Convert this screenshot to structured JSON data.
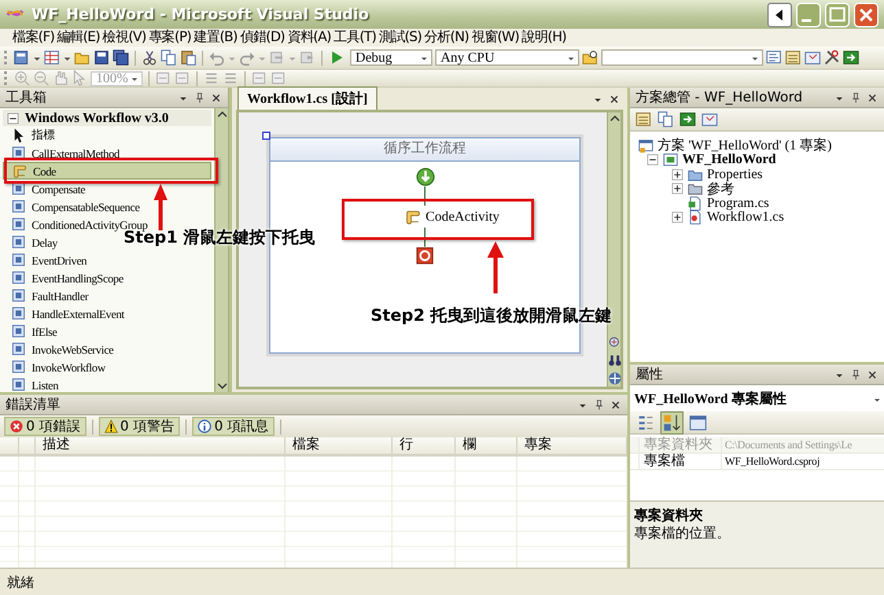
{
  "window": {
    "title": "WF_HelloWord - Microsoft Visual Studio"
  },
  "menu": [
    "檔案(F)",
    "編輯(E)",
    "檢視(V)",
    "專案(P)",
    "建置(B)",
    "偵錯(D)",
    "資料(A)",
    "工具(T)",
    "測試(S)",
    "分析(N)",
    "視窗(W)",
    "說明(H)"
  ],
  "toolbar": {
    "configuration": "Debug",
    "platform": "Any CPU",
    "zoom": "100%"
  },
  "toolbox": {
    "title": "工具箱",
    "group": {
      "label": "Windows Workflow v3.0",
      "expanded": true
    },
    "items": [
      {
        "label": "指標",
        "selected": false
      },
      {
        "label": "CallExternalMethod",
        "selected": false
      },
      {
        "label": "Code",
        "selected": true
      },
      {
        "label": "Compensate",
        "selected": false
      },
      {
        "label": "CompensatableSequence",
        "selected": false
      },
      {
        "label": "ConditionedActivityGroup",
        "selected": false
      },
      {
        "label": "Delay",
        "selected": false
      },
      {
        "label": "EventDriven",
        "selected": false
      },
      {
        "label": "EventHandlingScope",
        "selected": false
      },
      {
        "label": "FaultHandler",
        "selected": false
      },
      {
        "label": "HandleExternalEvent",
        "selected": false
      },
      {
        "label": "IfElse",
        "selected": false
      },
      {
        "label": "InvokeWebService",
        "selected": false
      },
      {
        "label": "InvokeWorkflow",
        "selected": false
      },
      {
        "label": "Listen",
        "selected": false
      }
    ]
  },
  "designer": {
    "tab": {
      "label": "Workflow1.cs [設計]",
      "selected": true
    },
    "workflow_title": "循序工作流程",
    "activities": [
      {
        "label": "CodeActivity"
      }
    ]
  },
  "solution_explorer": {
    "title": "方案總管 - WF_HelloWord",
    "tree": [
      {
        "kind": "solution",
        "label": "方案 'WF_HelloWord' (1 專案)",
        "children": [
          {
            "kind": "project",
            "label": "WF_HelloWord",
            "expanded": true,
            "children": [
              {
                "kind": "properties",
                "label": "Properties",
                "expanded": false
              },
              {
                "kind": "references",
                "label": "參考",
                "expanded": false
              },
              {
                "kind": "code",
                "label": "Program.cs"
              },
              {
                "kind": "workflow",
                "label": "Workflow1.cs",
                "expanded": false
              }
            ]
          }
        ]
      }
    ]
  },
  "properties": {
    "title": "屬性",
    "object": "WF_HelloWord 專案屬性",
    "sort_buttons": [
      {
        "kind": "categorized",
        "selected": false
      },
      {
        "kind": "alphabetical",
        "selected": true
      },
      {
        "kind": "pages",
        "selected": false
      }
    ],
    "rows": [
      {
        "name": "專案資料夾",
        "value": "C:\\Documents and Settings\\Le",
        "disabled": true
      },
      {
        "name": "專案檔",
        "value": "WF_HelloWord.csproj",
        "disabled": false
      }
    ],
    "description": {
      "title": "專案資料夾",
      "text": "專案檔的位置。"
    }
  },
  "error_list": {
    "title": "錯誤清單",
    "filters": [
      {
        "kind": "error",
        "label": "0 項錯誤",
        "on": true
      },
      {
        "kind": "warning",
        "label": "0 項警告",
        "on": true
      },
      {
        "kind": "message",
        "label": "0 項訊息",
        "on": true
      }
    ],
    "columns": [
      "描述",
      "檔案",
      "行",
      "欄",
      "專案"
    ]
  },
  "annotations": [
    {
      "text": "Step1 滑鼠左鍵按下托曳"
    },
    {
      "text": "Step2 托曳到這後放開滑鼠左鍵"
    }
  ],
  "status_bar": "就緒"
}
